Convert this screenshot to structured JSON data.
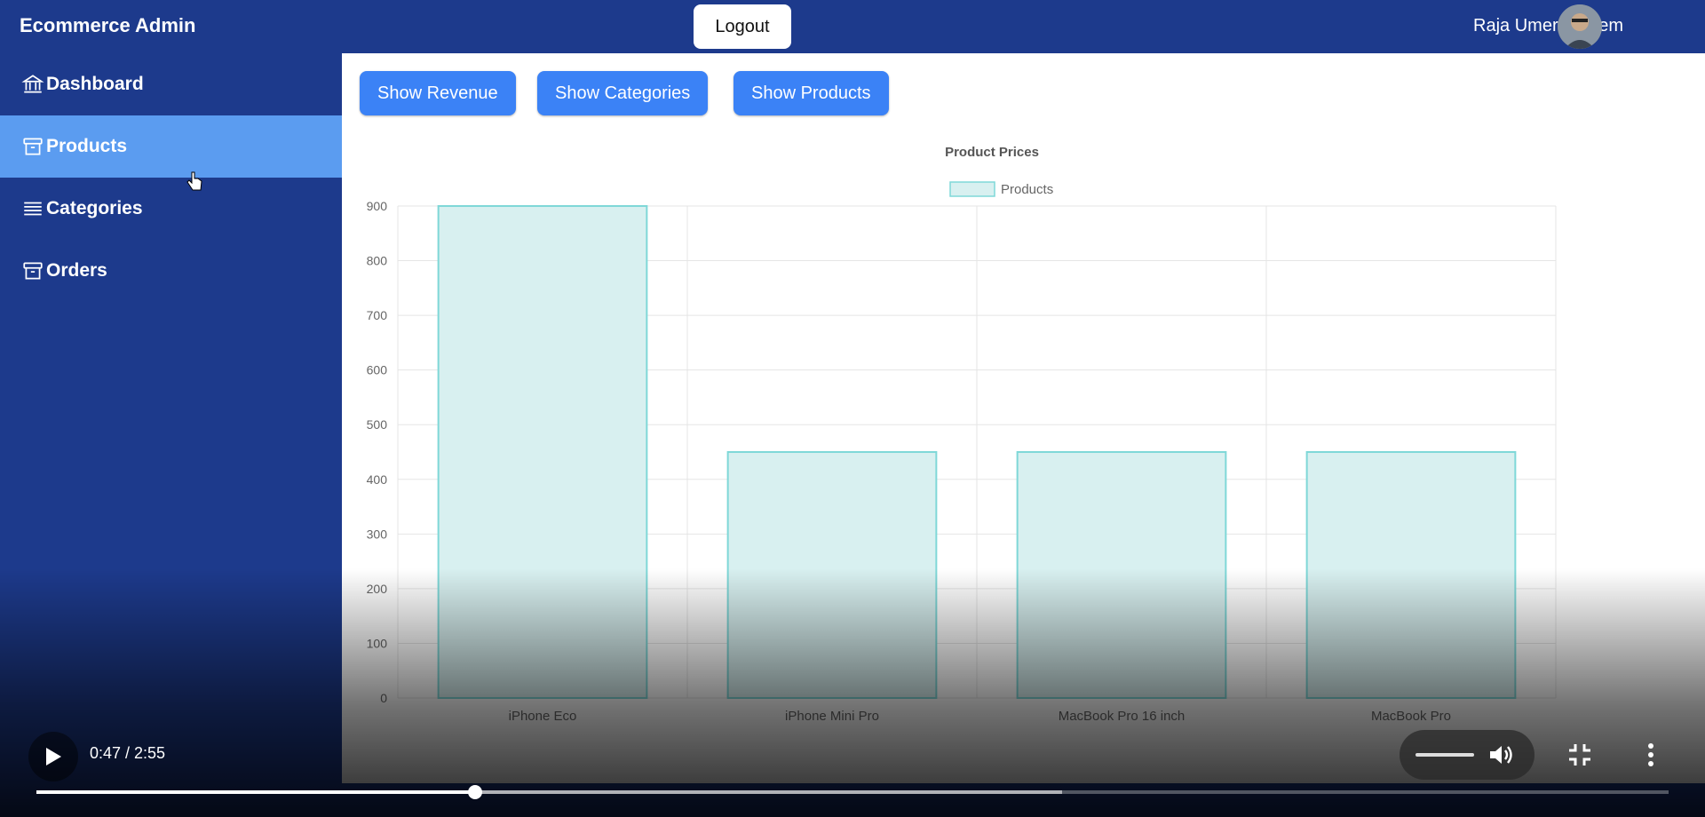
{
  "header": {
    "brand": "Ecommerce Admin",
    "logout_label": "Logout",
    "user_name": "Raja Umer Saleem"
  },
  "sidebar": {
    "items": [
      {
        "label": "Dashboard",
        "icon": "bank-icon",
        "active": false
      },
      {
        "label": "Products",
        "icon": "archive-box-icon",
        "active": true
      },
      {
        "label": "Categories",
        "icon": "list-icon",
        "active": false
      },
      {
        "label": "Orders",
        "icon": "archive-box-icon",
        "active": false
      }
    ]
  },
  "toolbar": {
    "show_revenue": "Show Revenue",
    "show_categories": "Show Categories",
    "show_products": "Show Products"
  },
  "chart_data": {
    "type": "bar",
    "title": "Product Prices",
    "categories": [
      "iPhone Eco",
      "iPhone Mini Pro",
      "MacBook Pro 16 inch",
      "MacBook Pro"
    ],
    "series": [
      {
        "name": "Products",
        "values": [
          900,
          450,
          450,
          450
        ]
      }
    ],
    "ylim": [
      0,
      900
    ],
    "yticks": [
      0,
      100,
      200,
      300,
      400,
      500,
      600,
      700,
      800,
      900
    ],
    "grid": true,
    "legend": "top-center",
    "colors": {
      "bar_fill": "#d8f0f0",
      "bar_border": "#7fd8d8"
    }
  },
  "player": {
    "time": "0:47 / 2:55",
    "progress": 0.2686,
    "buffered": 0.6285,
    "volume": 0.7
  },
  "colors": {
    "nav_bg": "#1d3a8c",
    "active_item": "#5b9cf0",
    "button": "#3b82f6"
  }
}
